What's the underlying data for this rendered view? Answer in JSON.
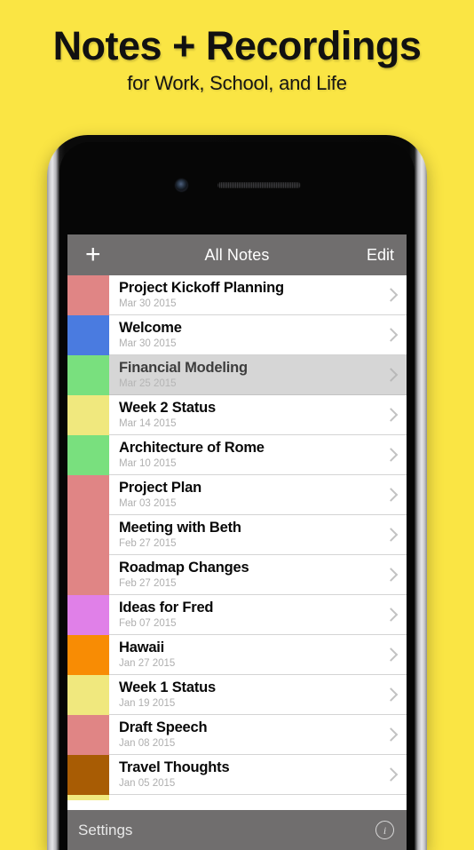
{
  "promo": {
    "title": "Notes + Recordings",
    "subtitle": "for Work, School, and Life",
    "background_color": "#FAE544"
  },
  "device": {
    "camera_icon": "camera-icon",
    "speaker_icon": "earpiece-speaker-icon",
    "buttons": [
      "mute-switch",
      "volume-up-button",
      "volume-down-button",
      "power-button"
    ]
  },
  "app": {
    "navbar": {
      "add_label": "+",
      "title": "All Notes",
      "edit_label": "Edit",
      "background_color": "#706E6E"
    },
    "notes": [
      {
        "title": "Project Kickoff Planning",
        "date": "Mar 30 2015",
        "color": "#E08585",
        "selected": false
      },
      {
        "title": "Welcome",
        "date": "Mar 30 2015",
        "color": "#4A7BE0",
        "selected": false
      },
      {
        "title": "Financial Modeling",
        "date": "Mar 25 2015",
        "color": "#79E07E",
        "selected": true
      },
      {
        "title": "Week 2 Status",
        "date": "Mar 14 2015",
        "color": "#F0E87E",
        "selected": false
      },
      {
        "title": "Architecture of Rome",
        "date": "Mar 10 2015",
        "color": "#79E07E",
        "selected": false
      },
      {
        "title": "Project Plan",
        "date": "Mar 03 2015",
        "color": "#E08585",
        "selected": false
      },
      {
        "title": "Meeting with Beth",
        "date": "Feb 27 2015",
        "color": "#E08585",
        "selected": false
      },
      {
        "title": "Roadmap Changes",
        "date": "Feb 27 2015",
        "color": "#E08585",
        "selected": false
      },
      {
        "title": "Ideas for Fred",
        "date": "Feb 07 2015",
        "color": "#E080E8",
        "selected": false
      },
      {
        "title": "Hawaii",
        "date": "Jan 27 2015",
        "color": "#F88C04",
        "selected": false
      },
      {
        "title": "Week 1 Status",
        "date": "Jan 19 2015",
        "color": "#F0E87E",
        "selected": false
      },
      {
        "title": "Draft Speech",
        "date": "Jan 08 2015",
        "color": "#E08585",
        "selected": false
      },
      {
        "title": "Travel Thoughts",
        "date": "Jan 05 2015",
        "color": "#A85C04",
        "selected": false
      }
    ],
    "partial_next_color": "#F0E87E",
    "toolbar": {
      "settings_label": "Settings",
      "info_label": "i",
      "info_icon": "info-circle-icon"
    }
  }
}
